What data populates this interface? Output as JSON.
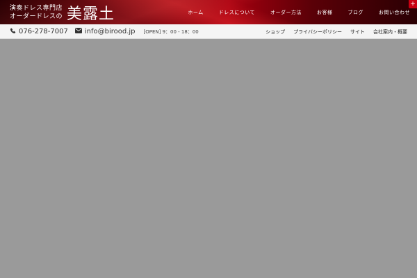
{
  "header": {
    "logo_line1": "演奏ドレス専門店",
    "logo_line2": "オーダードレスの",
    "logo_brand": "美露土",
    "nav": [
      {
        "label": "ホーム"
      },
      {
        "label": "ドレスについて"
      },
      {
        "label": "オーダー方法"
      },
      {
        "label": "お客様"
      },
      {
        "label": "ブログ"
      },
      {
        "label": "お問い合わせ"
      }
    ],
    "expand_symbol": "+"
  },
  "subbar": {
    "phone": "076-278-7007",
    "email": "info@birood.jp",
    "hours": "[OPEN] 9：00 - 18：00",
    "links": [
      {
        "label": "ショップ"
      },
      {
        "label": "プライバシーポリシー"
      },
      {
        "label": "サイト"
      },
      {
        "label": "会社案内・概要"
      }
    ]
  },
  "colors": {
    "header_red": "#a6000f",
    "accent_red": "#c80012",
    "subbar_bg": "#f4f4f4",
    "content_bg": "#9a9a9a"
  }
}
